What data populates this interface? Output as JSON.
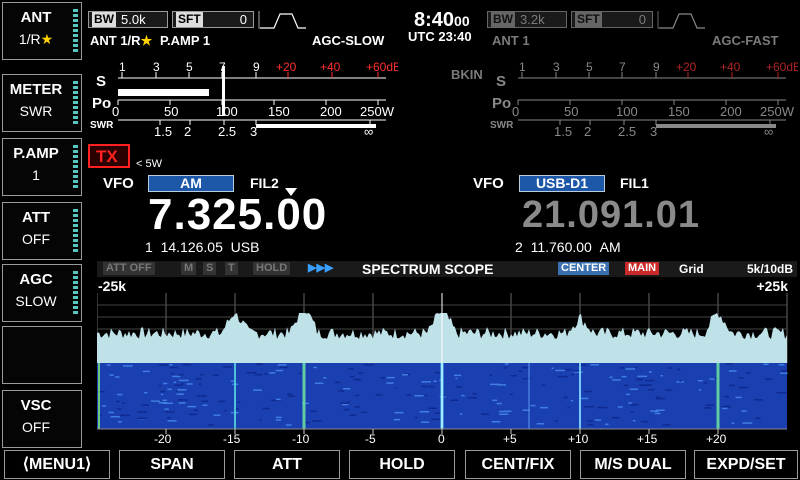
{
  "side_keys": [
    {
      "title": "ANT",
      "value": "1/R",
      "star": true
    },
    {
      "title": "METER",
      "value": "SWR"
    },
    {
      "title": "P.AMP",
      "value": "1"
    },
    {
      "title": "ATT",
      "value": "OFF"
    },
    {
      "title": "AGC",
      "value": "SLOW"
    },
    {
      "title": "",
      "value": ""
    },
    {
      "title": "VSC",
      "value": "OFF"
    }
  ],
  "main_rx": {
    "bw_label": "BW",
    "bw_value": "5.0k",
    "sft_label": "SFT",
    "sft_value": "0",
    "ant_label": "ANT 1/R",
    "pamp_label": "P.AMP 1",
    "agc_label": "AGC-SLOW",
    "tx_label": "TX",
    "power_label": "< 5W",
    "vfo_label": "VFO",
    "mode": "AM",
    "filter": "FIL2",
    "frequency": "7.325.00",
    "memo_channel": "1",
    "memo_freq": "14.126.05",
    "memo_mode": "USB"
  },
  "clock": {
    "time": "8:40",
    "seconds": "00",
    "utc_label": "UTC",
    "utc_time": "23:40"
  },
  "sub_rx": {
    "bw_label": "BW",
    "bw_value": "3.2k",
    "sft_label": "SFT",
    "sft_value": "0",
    "ant_label": "ANT 1",
    "agc_label": "AGC-FAST",
    "bkin_label": "BKIN",
    "vfo_label": "VFO",
    "mode": "USB-D1",
    "filter": "FIL1",
    "frequency": "21.091.01",
    "memo_channel": "2",
    "memo_freq": "11.760.00",
    "memo_mode": "AM"
  },
  "meter": {
    "s_label": "S",
    "po_label": "Po",
    "swr_label": "SWR",
    "s_ticks": [
      "1",
      "3",
      "5",
      "7",
      "9"
    ],
    "s_red_ticks": [
      "+20",
      "+40",
      "+60dB"
    ],
    "po_ticks": [
      "0",
      "50",
      "100",
      "150",
      "200",
      "250W"
    ],
    "swr_ticks": [
      "1.5",
      "2",
      "2.5",
      "3",
      "∞"
    ],
    "main_s_level": 0.34,
    "main_po_level": 0.34
  },
  "scope": {
    "status_tags": [
      "ATT OFF",
      "M",
      "S",
      "T",
      "HOLD",
      "▶▶▶"
    ],
    "title": "SPECTRUM  SCOPE",
    "center_tag": "CENTER",
    "main_tag": "MAIN",
    "grid_label": "Grid",
    "span_label": "5k/10dB",
    "left_edge": "-25k",
    "right_edge": "+25k",
    "axis_labels": [
      "-20",
      "-15",
      "-10",
      "-5",
      "0",
      "+5",
      "+10",
      "+15",
      "+20"
    ]
  },
  "bottom_keys": [
    "⟨MENU1⟩",
    "SPAN",
    "ATT",
    "HOLD",
    "CENT/FIX",
    "M/S DUAL",
    "EXPD/SET"
  ],
  "colors": {
    "accent": "#58c6c0",
    "mode_box": "#1c57a8",
    "tx_red": "#ff2020",
    "waterfall": "#1a3fb0"
  }
}
